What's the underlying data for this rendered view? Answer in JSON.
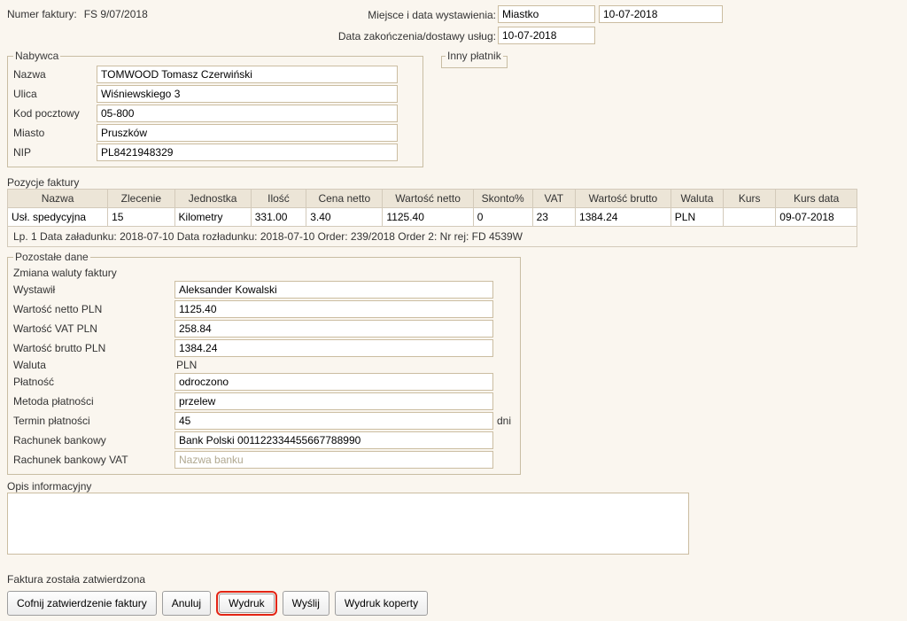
{
  "header": {
    "numer_label": "Numer faktury:",
    "numer_value": "FS 9/07/2018",
    "miejsce_label": "Miejsce i data wystawienia:",
    "miejsce_value": "Miastko",
    "data_wyst_value": "10-07-2018",
    "data_zak_label": "Data zakończenia/dostawy usług:",
    "data_zak_value": "10-07-2018"
  },
  "nabywca": {
    "legend": "Nabywca",
    "nazwa_label": "Nazwa",
    "nazwa": "TOMWOOD Tomasz Czerwiński",
    "ulica_label": "Ulica",
    "ulica": "Wiśniewskiego 3",
    "kod_label": "Kod pocztowy",
    "kod": "05-800",
    "miasto_label": "Miasto",
    "miasto": "Pruszków",
    "nip_label": "NIP",
    "nip": "PL8421948329"
  },
  "inny_platnik": {
    "legend": "Inny płatnik"
  },
  "pozycje": {
    "title": "Pozycje faktury",
    "headers": {
      "nazwa": "Nazwa",
      "zlecenie": "Zlecenie",
      "jednostka": "Jednostka",
      "ilosc": "Ilość",
      "cena_netto": "Cena netto",
      "wartosc_netto": "Wartość netto",
      "skonto": "Skonto%",
      "vat": "VAT",
      "wartosc_brutto": "Wartość brutto",
      "waluta": "Waluta",
      "kurs": "Kurs",
      "kurs_data": "Kurs data"
    },
    "row": {
      "nazwa": "Usł. spedycyjna",
      "zlecenie": "15",
      "jednostka": "Kilometry",
      "ilosc": "331.00",
      "cena_netto": "3.40",
      "wartosc_netto": "1125.40",
      "skonto": "0",
      "vat": "23",
      "wartosc_brutto": "1384.24",
      "waluta": "PLN",
      "kurs": "",
      "kurs_data": "09-07-2018"
    },
    "lp_text": "Lp. 1  Data załadunku: 2018-07-10 Data rozładunku: 2018-07-10 Order: 239/2018 Order 2: Nr rej: FD 4539W"
  },
  "pozostale": {
    "legend": "Pozostałe dane",
    "zmiana_label": "Zmiana waluty faktury",
    "wystawil_label": "Wystawił",
    "wystawil": "Aleksander Kowalski",
    "wnetto_label": "Wartość netto PLN",
    "wnetto": "1125.40",
    "wvat_label": "Wartość VAT PLN",
    "wvat": "258.84",
    "wbrutto_label": "Wartość brutto PLN",
    "wbrutto": "1384.24",
    "waluta_label": "Waluta",
    "waluta": "PLN",
    "platnosc_label": "Płatność",
    "platnosc": "odroczono",
    "metoda_label": "Metoda płatności",
    "metoda": "przelew",
    "termin_label": "Termin płatności",
    "termin": "45",
    "termin_suffix": "dni",
    "rachunek_label": "Rachunek bankowy",
    "rachunek": "Bank Polski 001122334455667788990",
    "rachunek_vat_label": "Rachunek bankowy VAT",
    "rachunek_vat_placeholder": "Nazwa banku"
  },
  "opis": {
    "label": "Opis informacyjny",
    "value": ""
  },
  "footer": {
    "status": "Faktura została zatwierdzona",
    "cofnij": "Cofnij zatwierdzenie faktury",
    "anuluj": "Anuluj",
    "wydruk": "Wydruk",
    "wyslij": "Wyślij",
    "wydruk_koperty": "Wydruk koperty"
  }
}
